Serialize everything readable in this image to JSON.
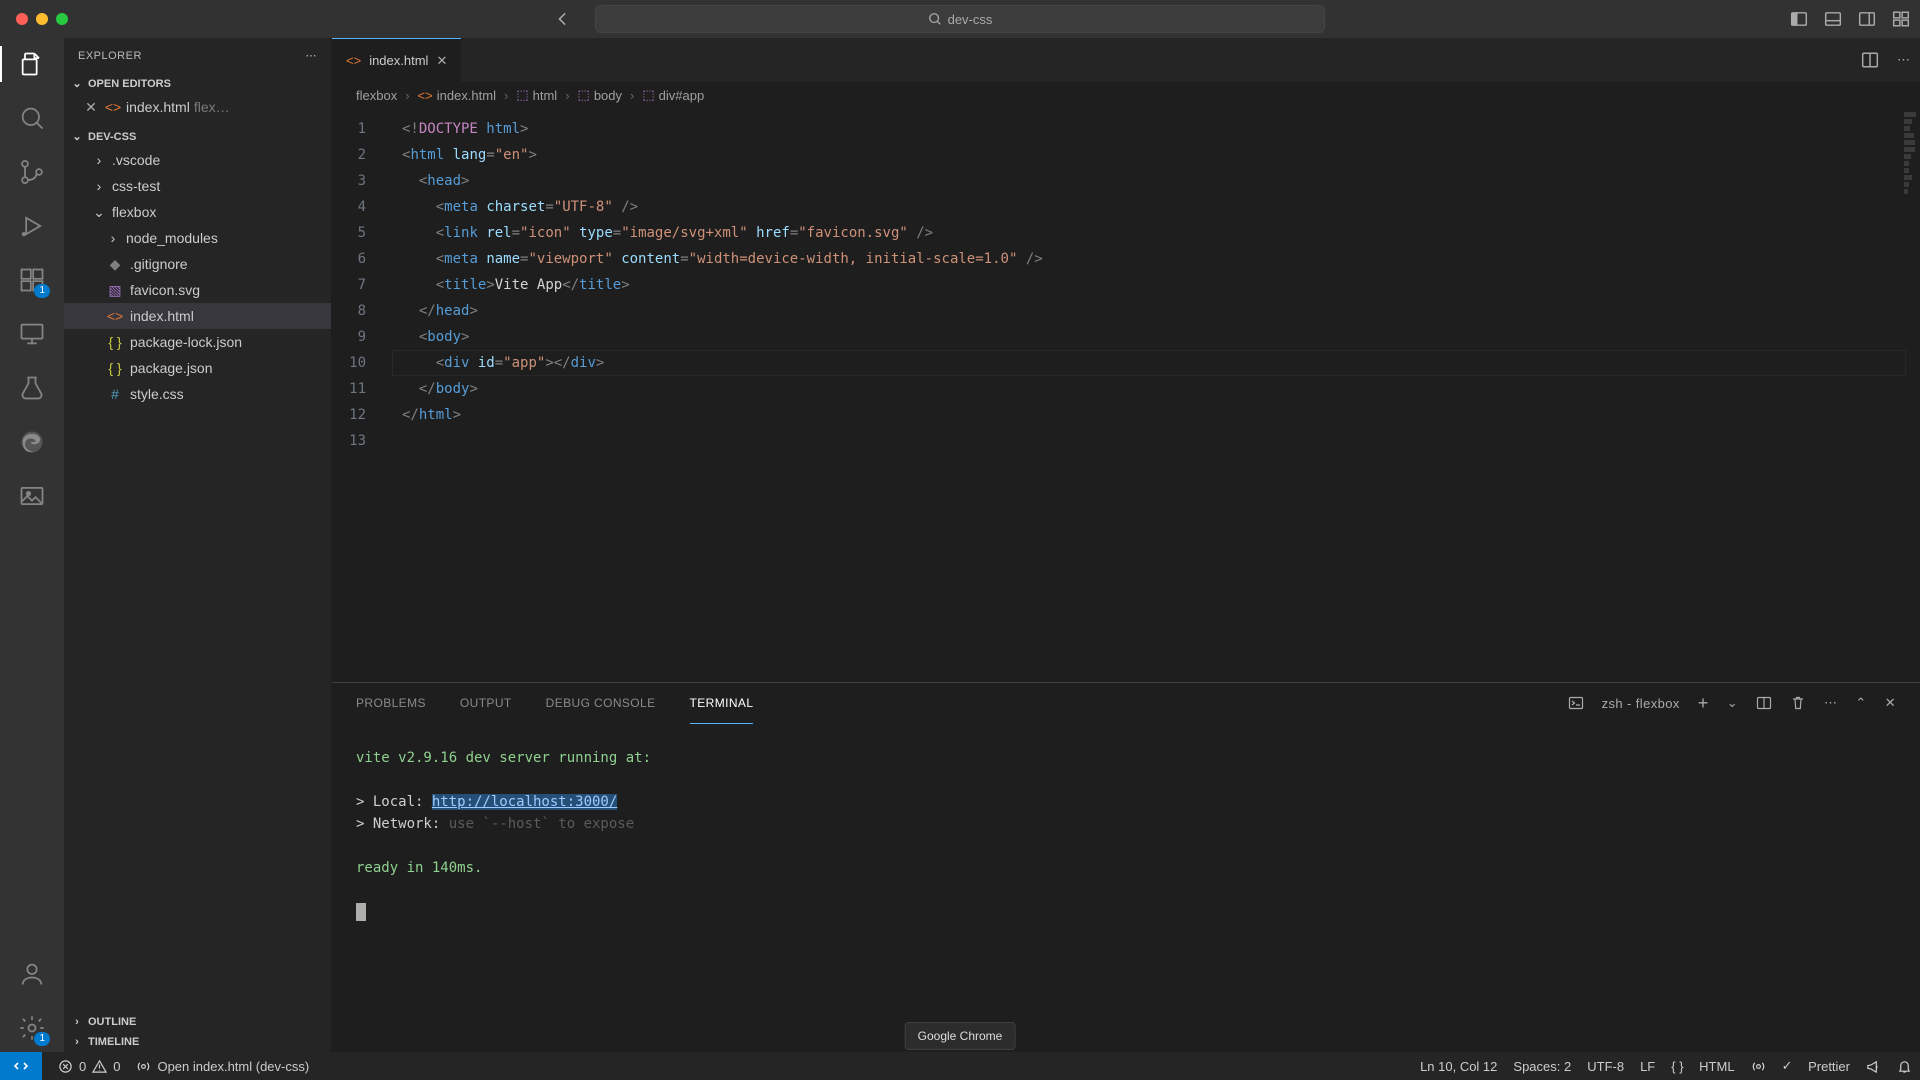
{
  "title": "dev-css",
  "search_placeholder": "dev-css",
  "explorer_title": "EXPLORER",
  "sections": {
    "open_editors": "OPEN EDITORS",
    "workspace": "DEV-CSS",
    "outline": "OUTLINE",
    "timeline": "TIMELINE"
  },
  "open_editors": [
    {
      "name": "index.html",
      "hint": "flex…"
    }
  ],
  "tree": {
    "folders": [
      {
        "name": ".vscode"
      },
      {
        "name": "css-test"
      },
      {
        "name": "flexbox",
        "expanded": true,
        "children": [
          {
            "name": "node_modules",
            "folder": true
          },
          {
            "name": ".gitignore",
            "icon": "git"
          },
          {
            "name": "favicon.svg",
            "icon": "svg"
          },
          {
            "name": "index.html",
            "icon": "html",
            "selected": true
          },
          {
            "name": "package-lock.json",
            "icon": "json"
          },
          {
            "name": "package.json",
            "icon": "json"
          },
          {
            "name": "style.css",
            "icon": "css"
          }
        ]
      }
    ]
  },
  "tab": {
    "name": "index.html"
  },
  "breadcrumbs": [
    "flexbox",
    "index.html",
    "html",
    "body",
    "div#app"
  ],
  "code_lines": 13,
  "code_tokens": [
    [
      [
        "p",
        "<!"
      ],
      [
        "kw",
        "DOCTYPE "
      ],
      [
        "tg",
        "html"
      ],
      [
        "p",
        ">"
      ]
    ],
    [
      [
        "p",
        "<"
      ],
      [
        "tg",
        "html "
      ],
      [
        "at",
        "lang"
      ],
      [
        "p",
        "="
      ],
      [
        "st",
        "\"en\""
      ],
      [
        "p",
        ">"
      ]
    ],
    [
      [
        "p",
        "  <"
      ],
      [
        "tg",
        "head"
      ],
      [
        "p",
        ">"
      ]
    ],
    [
      [
        "p",
        "    <"
      ],
      [
        "tg",
        "meta "
      ],
      [
        "at",
        "charset"
      ],
      [
        "p",
        "="
      ],
      [
        "st",
        "\"UTF-8\""
      ],
      [
        "p",
        " />"
      ]
    ],
    [
      [
        "p",
        "    <"
      ],
      [
        "tg",
        "link "
      ],
      [
        "at",
        "rel"
      ],
      [
        "p",
        "="
      ],
      [
        "st",
        "\"icon\""
      ],
      [
        "p",
        " "
      ],
      [
        "at",
        "type"
      ],
      [
        "p",
        "="
      ],
      [
        "st",
        "\"image/svg+xml\""
      ],
      [
        "p",
        " "
      ],
      [
        "at",
        "href"
      ],
      [
        "p",
        "="
      ],
      [
        "st",
        "\"favicon.svg\""
      ],
      [
        "p",
        " />"
      ]
    ],
    [
      [
        "p",
        "    <"
      ],
      [
        "tg",
        "meta "
      ],
      [
        "at",
        "name"
      ],
      [
        "p",
        "="
      ],
      [
        "st",
        "\"viewport\""
      ],
      [
        "p",
        " "
      ],
      [
        "at",
        "content"
      ],
      [
        "p",
        "="
      ],
      [
        "st",
        "\"width=device-width, initial-scale=1.0\""
      ],
      [
        "p",
        " />"
      ]
    ],
    [
      [
        "p",
        "    <"
      ],
      [
        "tg",
        "title"
      ],
      [
        "p",
        ">"
      ],
      [
        "tx",
        "Vite App"
      ],
      [
        "p",
        "</"
      ],
      [
        "tg",
        "title"
      ],
      [
        "p",
        ">"
      ]
    ],
    [
      [
        "p",
        "  </"
      ],
      [
        "tg",
        "head"
      ],
      [
        "p",
        ">"
      ]
    ],
    [
      [
        "p",
        "  <"
      ],
      [
        "tg",
        "body"
      ],
      [
        "p",
        ">"
      ]
    ],
    [
      [
        "p",
        "    <"
      ],
      [
        "tg",
        "div "
      ],
      [
        "at",
        "id"
      ],
      [
        "p",
        "="
      ],
      [
        "st",
        "\"app\""
      ],
      [
        "p",
        "></"
      ],
      [
        "tg",
        "div"
      ],
      [
        "p",
        ">"
      ]
    ],
    [
      [
        "p",
        "  </"
      ],
      [
        "tg",
        "body"
      ],
      [
        "p",
        ">"
      ]
    ],
    [
      [
        "p",
        "</"
      ],
      [
        "tg",
        "html"
      ],
      [
        "p",
        ">"
      ]
    ],
    [
      [
        "tx",
        ""
      ]
    ]
  ],
  "cursor_line": 10,
  "terminal": {
    "shell_label": "zsh - flexbox",
    "lines": {
      "vite": "vite v2.9.16 dev server running at:",
      "local_prefix": "> Local:   ",
      "local_url": "http://localhost:3000/",
      "network": "> Network: ",
      "network_hint": "use `--host` to expose",
      "ready": "ready in 140ms."
    }
  },
  "panel_tabs": {
    "problems": "PROBLEMS",
    "output": "OUTPUT",
    "debug": "DEBUG CONSOLE",
    "terminal": "TERMINAL"
  },
  "status": {
    "errors": "0",
    "warnings": "0",
    "open_hint": "Open index.html (dev-css)",
    "ln_col": "Ln 10, Col 12",
    "spaces": "Spaces: 2",
    "encoding": "UTF-8",
    "eol": "LF",
    "lang": "HTML",
    "prettier": "Prettier"
  },
  "tooltip": "Google Chrome",
  "activity_badges": {
    "ext": "1",
    "settings": "1"
  }
}
